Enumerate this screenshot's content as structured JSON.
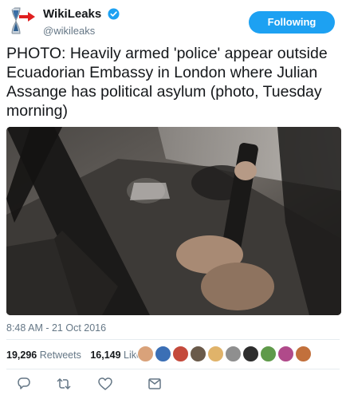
{
  "user": {
    "display_name": "WikiLeaks",
    "handle": "@wikileaks",
    "verified": true,
    "follow_button_label": "Following"
  },
  "tweet": {
    "text": "PHOTO: Heavily armed 'police' appear outside Ecuadorian Embassy in London where Julian Assange has political asylum (photo, Tuesday morning)",
    "timestamp": "8:48 AM - 21 Oct 2016"
  },
  "stats": {
    "retweets_count": "19,296",
    "retweets_label": "Retweets",
    "likes_count": "16,149",
    "likes_label": "Likes"
  },
  "icons": {
    "verified": "verified-badge-icon",
    "reply": "reply-icon",
    "retweet": "retweet-icon",
    "like": "heart-icon",
    "message": "direct-message-icon"
  },
  "colors": {
    "accent": "#1da1f2",
    "text": "#14171a",
    "secondary_text": "#657786",
    "divider": "#e6ecf0",
    "arrow_red": "#e02020"
  }
}
